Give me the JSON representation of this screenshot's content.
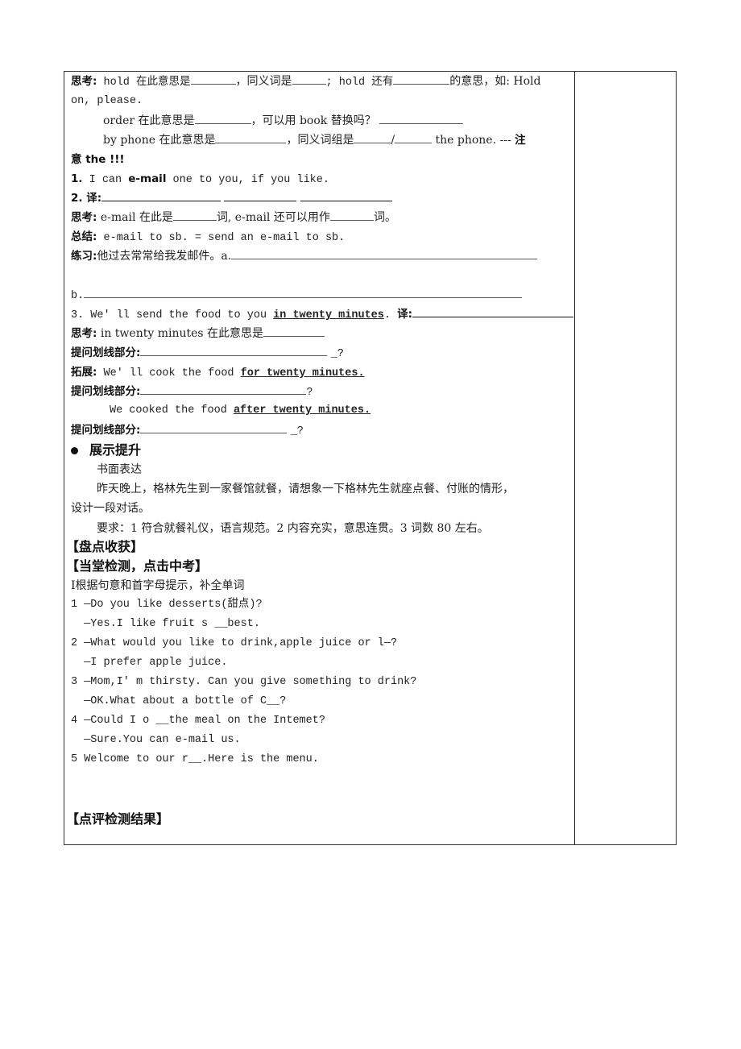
{
  "think1": {
    "label": "思考:",
    "p1": " hold 在此意思是",
    "p2": "，同义词是",
    "p3": "; hold 还有",
    "p4": "的意思，如: Hold",
    "p5": "on, please."
  },
  "order_line": {
    "p1": "order 在此意思是",
    "p2": "，可以用 book 替换吗？"
  },
  "phone_line": {
    "p1": "by phone 在此意思是",
    "p2": "，同义词组是",
    "p3": "/",
    "p4": " the phone. --- ",
    "note1": "注",
    "note2": "意 the !!!"
  },
  "item1": {
    "num": "1.",
    "pre": " I can ",
    "bold": "e-mail",
    "post": " one to you, if you like."
  },
  "item2": {
    "num": "2.",
    "label": " 译:"
  },
  "think2": {
    "label": "思考:",
    "p1": " e-mail 在此是",
    "p2": "词, e-mail 还可以用作",
    "p3": "词。"
  },
  "summary": {
    "label": "总结:",
    "text": " e-mail to sb. = send an e-mail to sb."
  },
  "practice": {
    "label": "练习:",
    "text": "他过去常常给我发邮件。a.",
    "b_label": "b."
  },
  "item3": {
    "pre": "3. We' ll send the food to you ",
    "underlined": "in twenty minutes",
    "post": ".  ",
    "trans": "译:"
  },
  "think3": {
    "label": "思考:",
    "text": " in twenty minutes 在此意思是"
  },
  "ask1": {
    "label": "提问划线部分:",
    "end": "_?"
  },
  "extend": {
    "label": "拓展:",
    "pre": " We' ll cook the food ",
    "underlined": "for twenty minutes."
  },
  "ask2": {
    "label": "提问划线部分:",
    "end": "?"
  },
  "cooked": {
    "pre": "We cooked the food ",
    "underlined": "after twenty minutes."
  },
  "ask3": {
    "label": "提问划线部分:",
    "end": "_?"
  },
  "show": {
    "heading": "展示提升",
    "sub": "书面表达",
    "para1": "昨天晚上，格林先生到一家餐馆就餐，请想象一下格林先生就座点餐、付账的情形，",
    "para2": "设计一段对话。",
    "req": "要求：1 符合就餐礼仪，语言规范。2 内容充实，意思连贯。3 词数 80 左右。"
  },
  "harvest": "【盘点收获】",
  "test_heading": "【当堂检测，点击中考】",
  "test_intro": "Ⅰ根据句意和首字母提示，补全单词",
  "exercises": [
    "1 —Do you like desserts(甜点)?",
    "  —Yes.I like fruit s __best.",
    "2 —What would you like to drink,apple juice or l—?",
    "  —I prefer apple juice.",
    "3 —Mom,I' m thirsty. Can you give something to drink?",
    "  —OK.What about a bottle of C__?",
    "4 —Could I o __the meal on the Intemet?",
    "  —Sure.You can e-mail us.",
    "5 Welcome to our r__.Here is the menu."
  ],
  "review": "【点评检测结果】"
}
